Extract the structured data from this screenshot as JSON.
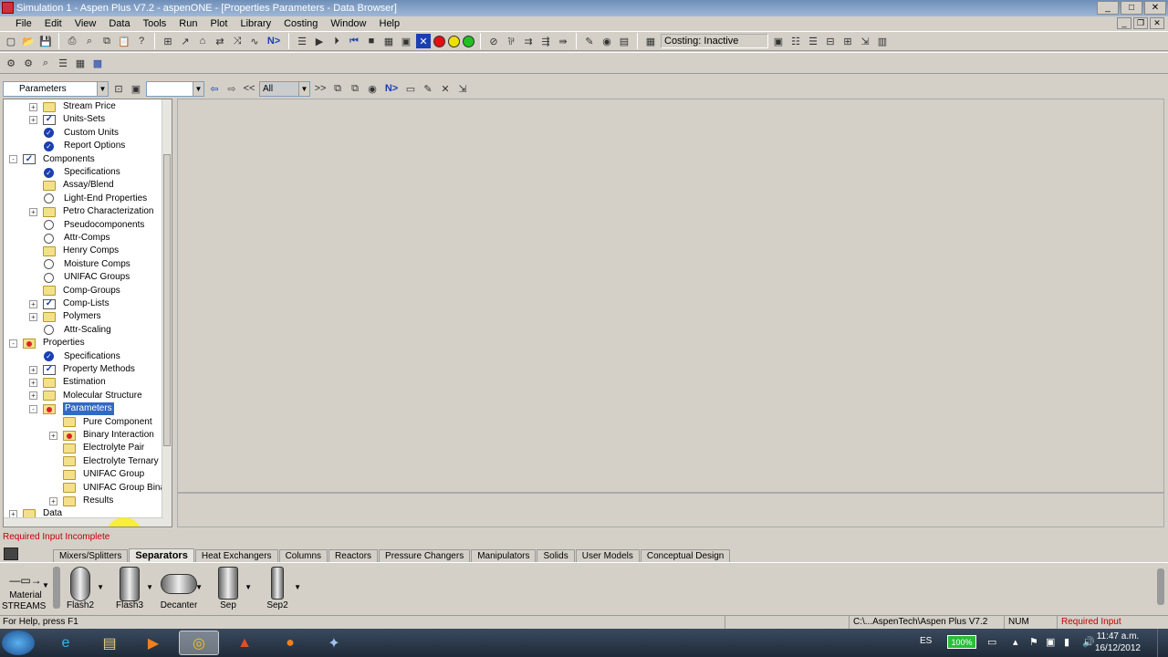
{
  "window": {
    "title": "Simulation 1 - Aspen Plus V7.2 - aspenONE - [Properties Parameters - Data Browser]"
  },
  "menu": [
    "File",
    "Edit",
    "View",
    "Data",
    "Tools",
    "Run",
    "Plot",
    "Library",
    "Costing",
    "Window",
    "Help"
  ],
  "toolbar": {
    "costing_status": "Costing: Inactive",
    "next_label": "N>"
  },
  "browser": {
    "form_select": "Parameters",
    "nav_back": "<<",
    "nav_forward": ">>",
    "view_select": "All",
    "next_label": "N>"
  },
  "tree": [
    {
      "label": "Stream Price",
      "level": 2,
      "icon": "folder",
      "expander": "+"
    },
    {
      "label": "Units-Sets",
      "level": 2,
      "icon": "check",
      "expander": "+"
    },
    {
      "label": "Custom Units",
      "level": 2,
      "icon": "bluecheck",
      "expander": ""
    },
    {
      "label": "Report Options",
      "level": 2,
      "icon": "bluecheck",
      "expander": ""
    },
    {
      "label": "Components",
      "level": 1,
      "icon": "check",
      "expander": "-"
    },
    {
      "label": "Specifications",
      "level": 2,
      "icon": "bluecheck",
      "expander": ""
    },
    {
      "label": "Assay/Blend",
      "level": 2,
      "icon": "folder",
      "expander": ""
    },
    {
      "label": "Light-End Properties",
      "level": 2,
      "icon": "circle",
      "expander": ""
    },
    {
      "label": "Petro Characterization",
      "level": 2,
      "icon": "folder",
      "expander": "+"
    },
    {
      "label": "Pseudocomponents",
      "level": 2,
      "icon": "circle",
      "expander": ""
    },
    {
      "label": "Attr-Comps",
      "level": 2,
      "icon": "circle",
      "expander": ""
    },
    {
      "label": "Henry Comps",
      "level": 2,
      "icon": "folder",
      "expander": ""
    },
    {
      "label": "Moisture Comps",
      "level": 2,
      "icon": "circle",
      "expander": ""
    },
    {
      "label": "UNIFAC Groups",
      "level": 2,
      "icon": "circle",
      "expander": ""
    },
    {
      "label": "Comp-Groups",
      "level": 2,
      "icon": "folder",
      "expander": ""
    },
    {
      "label": "Comp-Lists",
      "level": 2,
      "icon": "check",
      "expander": "+"
    },
    {
      "label": "Polymers",
      "level": 2,
      "icon": "folder",
      "expander": "+"
    },
    {
      "label": "Attr-Scaling",
      "level": 2,
      "icon": "circle",
      "expander": ""
    },
    {
      "label": "Properties",
      "level": 1,
      "icon": "folder-red",
      "expander": "-"
    },
    {
      "label": "Specifications",
      "level": 2,
      "icon": "bluecheck",
      "expander": ""
    },
    {
      "label": "Property Methods",
      "level": 2,
      "icon": "check",
      "expander": "+"
    },
    {
      "label": "Estimation",
      "level": 2,
      "icon": "folder",
      "expander": "+"
    },
    {
      "label": "Molecular Structure",
      "level": 2,
      "icon": "folder",
      "expander": "+"
    },
    {
      "label": "Parameters",
      "level": 2,
      "icon": "folder-red",
      "expander": "-",
      "selected": true
    },
    {
      "label": "Pure Component",
      "level": 3,
      "icon": "folder",
      "expander": ""
    },
    {
      "label": "Binary Interaction",
      "level": 3,
      "icon": "folder-red",
      "expander": "+"
    },
    {
      "label": "Electrolyte Pair",
      "level": 3,
      "icon": "folder",
      "expander": ""
    },
    {
      "label": "Electrolyte Ternary",
      "level": 3,
      "icon": "folder",
      "expander": ""
    },
    {
      "label": "UNIFAC Group",
      "level": 3,
      "icon": "folder",
      "expander": ""
    },
    {
      "label": "UNIFAC Group Bina",
      "level": 3,
      "icon": "folder",
      "expander": ""
    },
    {
      "label": "Results",
      "level": 3,
      "icon": "folder",
      "expander": "+"
    },
    {
      "label": "Data",
      "level": 1,
      "icon": "folder",
      "expander": "+"
    }
  ],
  "status": {
    "required_input": "Required Input Incomplete"
  },
  "library": {
    "tabs": [
      "Mixers/Splitters",
      "Separators",
      "Heat Exchangers",
      "Columns",
      "Reactors",
      "Pressure Changers",
      "Manipulators",
      "Solids",
      "User Models",
      "Conceptual Design"
    ],
    "active_tab": "Separators",
    "material_label": "Material",
    "streams_label": "STREAMS",
    "models": [
      "Flash2",
      "Flash3",
      "Decanter",
      "Sep",
      "Sep2"
    ]
  },
  "statusbar": {
    "help": "For Help, press F1",
    "path": "C:\\...AspenTech\\Aspen Plus V7.2",
    "num": "NUM",
    "required": "Required Input Incomplete"
  },
  "taskbar": {
    "lang": "ES",
    "battery": "100%",
    "time": "11:47 a.m.",
    "date": "16/12/2012"
  },
  "colors": {
    "selection": "#316ac5",
    "required_text": "#c00000",
    "highlight": "#fff000"
  }
}
